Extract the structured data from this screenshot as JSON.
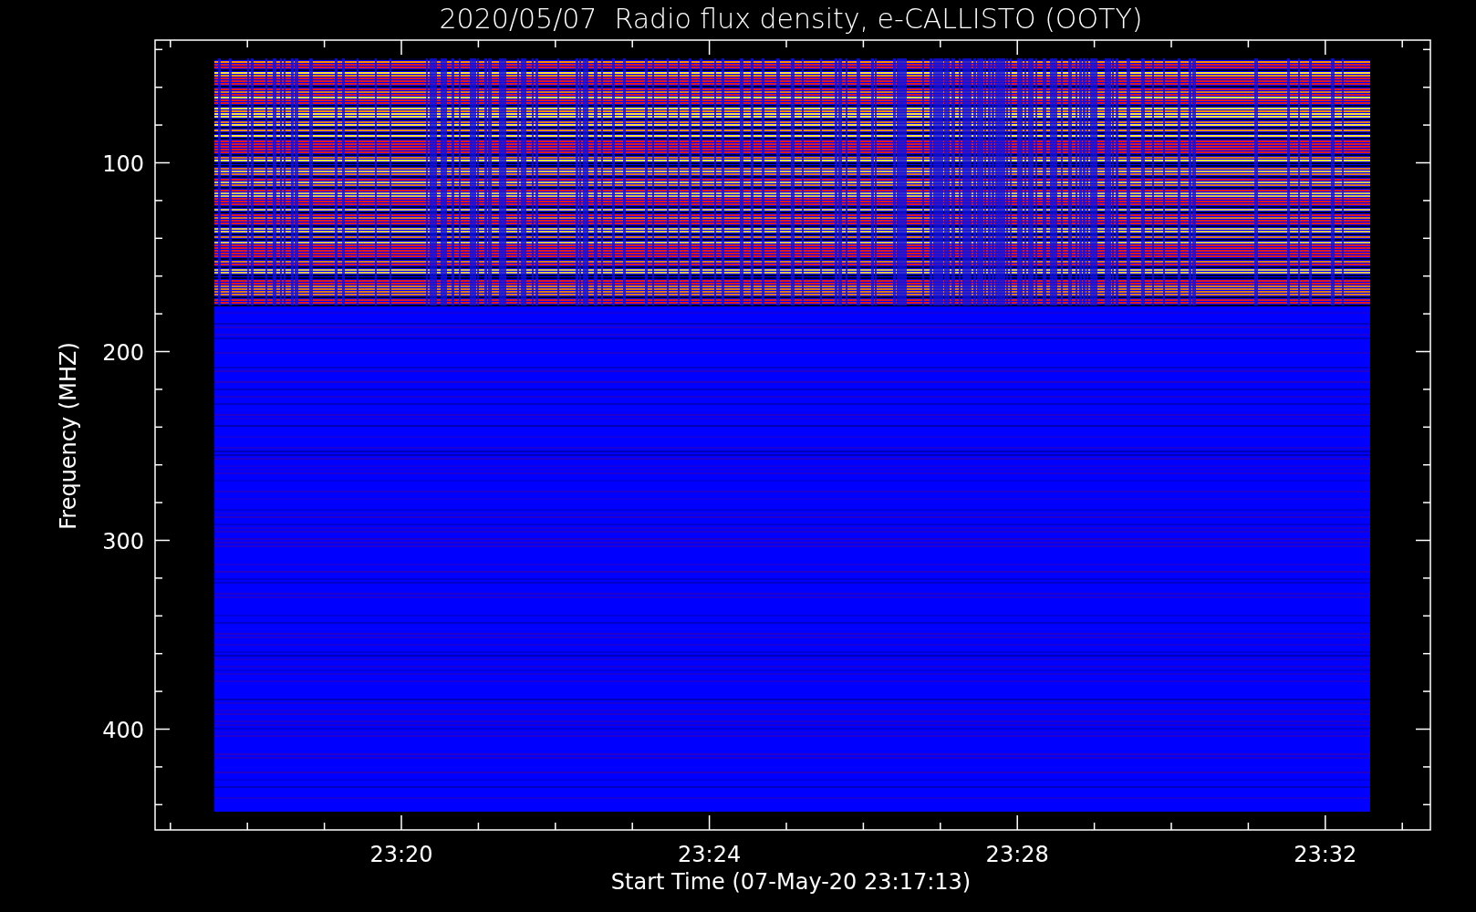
{
  "title": "2020/05/07  Radio flux density, e-CALLISTO (OOTY)",
  "x_axis": {
    "label": "Start Time (07-May-20 23:17:13)",
    "ticks": [
      "23:20",
      "23:24",
      "23:28",
      "23:32"
    ]
  },
  "y_axis": {
    "label": "Frequency (MHZ)",
    "ticks": [
      "100",
      "200",
      "300",
      "400"
    ]
  }
}
